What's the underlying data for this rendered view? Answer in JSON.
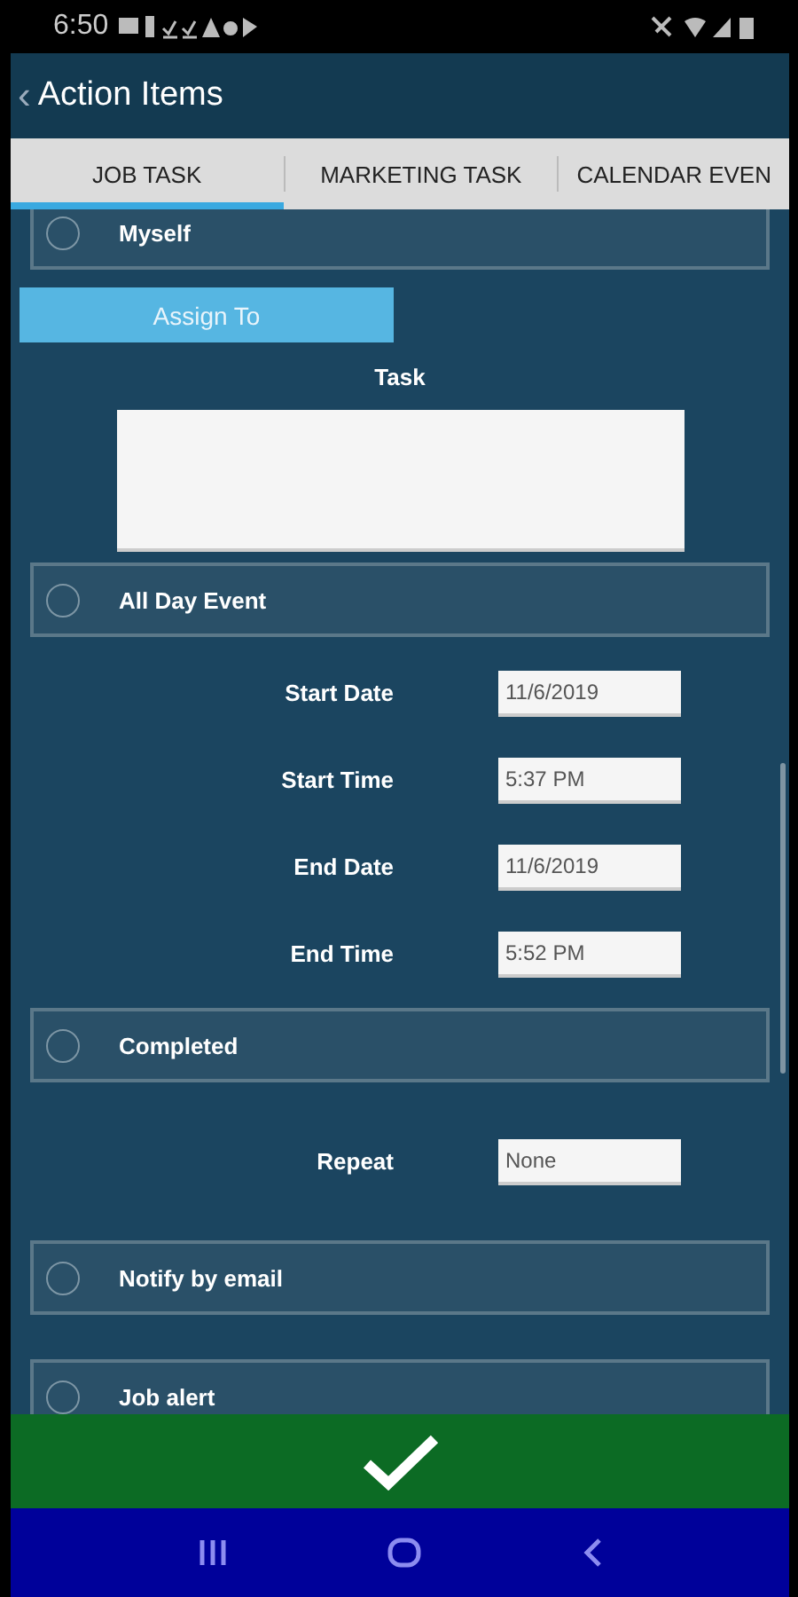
{
  "status_bar": {
    "time": "6:50"
  },
  "header": {
    "back": "‹",
    "title": "Action Items"
  },
  "tabs": [
    {
      "label": "JOB TASK",
      "selected": true
    },
    {
      "label": "MARKETING TASK",
      "selected": false
    },
    {
      "label": "CALENDAR EVEN",
      "selected": false
    }
  ],
  "form": [
    {
      "kind": "toggle",
      "label": "Myself",
      "checked": false
    },
    {
      "kind": "button",
      "label": "Assign To"
    },
    {
      "kind": "textarea",
      "label": "Task"
    },
    {
      "kind": "toggle",
      "label": "All Day Event",
      "checked": false
    },
    {
      "kind": "field",
      "label": "Start Date",
      "value": "11/6/2019"
    },
    {
      "kind": "field",
      "label": "Start Time",
      "value": "5:37 PM"
    },
    {
      "kind": "field",
      "label": "End Date",
      "value": "11/6/2019"
    },
    {
      "kind": "field",
      "label": "End Time",
      "value": "5:52 PM"
    },
    {
      "kind": "toggle",
      "label": "Completed",
      "checked": false
    },
    {
      "kind": "field",
      "label": "Repeat",
      "value": "None"
    },
    {
      "kind": "toggle",
      "label": "Notify by email",
      "checked": false
    },
    {
      "kind": "toggle",
      "label": "Job alert",
      "checked": false
    }
  ]
}
